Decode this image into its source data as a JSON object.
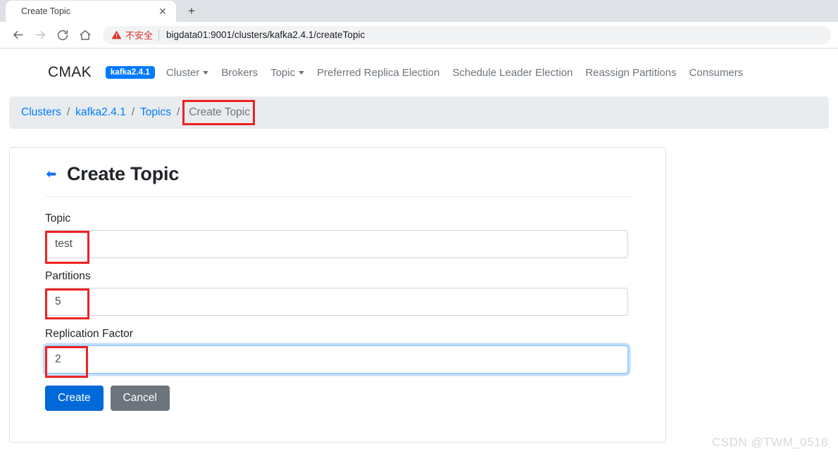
{
  "browser": {
    "tab": {
      "title": "Create Topic",
      "close_icon": "close-icon",
      "new_tab_icon": "plus-icon"
    },
    "toolbar": {
      "back_icon": "back-arrow-icon",
      "forward_icon": "forward-arrow-icon",
      "reload_icon": "reload-icon",
      "home_icon": "home-icon",
      "warning_icon": "warning-triangle-icon",
      "security_label": "不安全",
      "url_host": "bigdata01:9001",
      "url_path": "/clusters/kafka2.4.1/createTopic",
      "url_full": "bigdata01:9001/clusters/kafka2.4.1/createTopic"
    }
  },
  "navbar": {
    "brand": "CMAK",
    "cluster_badge": "kafka2.4.1",
    "items": [
      {
        "label": "Cluster",
        "has_caret": true
      },
      {
        "label": "Brokers",
        "has_caret": false
      },
      {
        "label": "Topic",
        "has_caret": true
      },
      {
        "label": "Preferred Replica Election",
        "has_caret": false
      },
      {
        "label": "Schedule Leader Election",
        "has_caret": false
      },
      {
        "label": "Reassign Partitions",
        "has_caret": false
      },
      {
        "label": "Consumers",
        "has_caret": false
      }
    ]
  },
  "breadcrumb": {
    "items": [
      {
        "label": "Clusters",
        "active": false
      },
      {
        "label": "kafka2.4.1",
        "active": false
      },
      {
        "label": "Topics",
        "active": false
      },
      {
        "label": "Create Topic",
        "active": true
      }
    ],
    "separator": "/"
  },
  "card": {
    "back_icon": "back-arrow-icon",
    "title": "Create Topic",
    "fields": [
      {
        "label": "Topic",
        "value": "test",
        "focused": false,
        "highlighted": true
      },
      {
        "label": "Partitions",
        "value": "5",
        "focused": false,
        "highlighted": true
      },
      {
        "label": "Replication Factor",
        "value": "2",
        "focused": true,
        "highlighted": true
      }
    ],
    "buttons": {
      "submit": "Create",
      "cancel": "Cancel"
    }
  },
  "watermark": "CSDN @TWM_0518",
  "colors": {
    "accent_blue": "#007bff",
    "button_blue": "#0069d9",
    "button_gray": "#6c757d",
    "breadcrumb_bg": "#e9ecef",
    "annotation_red": "#ee2222",
    "insecure_red": "#d93025",
    "tabstrip_bg": "#dee1e6"
  }
}
